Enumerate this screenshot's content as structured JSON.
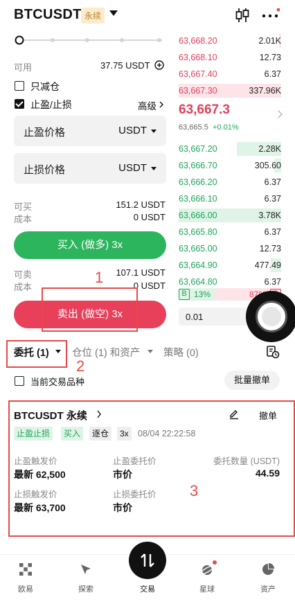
{
  "header": {
    "pair": "BTCUSDT",
    "badge": "永续"
  },
  "form": {
    "available_label": "可用",
    "available_value": "37.75 USDT",
    "reduce_only_label": "只减仓",
    "tpsl_label": "止盈/止损",
    "advanced_label": "高级",
    "tp_field_label": "止盈价格",
    "tp_field_unit": "USDT",
    "sl_field_label": "止损价格",
    "sl_field_unit": "USDT",
    "can_buy_label": "可买",
    "can_buy_value": "151.2 USDT",
    "cost_label": "成本",
    "cost_buy_value": "0 USDT",
    "buy_button": "买入 (做多) 3x",
    "can_sell_label": "可卖",
    "can_sell_value": "107.1 USDT",
    "cost_sell_value": "0 USDT",
    "sell_button": "卖出 (做空) 3x"
  },
  "orderbook": {
    "asks": [
      {
        "price": "63,668.20",
        "qty": "2.01K",
        "depth": 0.02
      },
      {
        "price": "63,668.10",
        "qty": "12.73",
        "depth": 0.0
      },
      {
        "price": "63,667.40",
        "qty": "6.37",
        "depth": 0.0
      },
      {
        "price": "63,667.30",
        "qty": "337.96K",
        "depth": 1.0
      }
    ],
    "last_price": "63,667.3",
    "mark_price": "63,665.5",
    "change": "+0.01%",
    "bids": [
      {
        "price": "63,667.20",
        "qty": "2.28K",
        "depth": 0.43
      },
      {
        "price": "63,666.70",
        "qty": "305.60",
        "depth": 0.07
      },
      {
        "price": "63,666.20",
        "qty": "6.37",
        "depth": 0.0
      },
      {
        "price": "63,666.10",
        "qty": "6.37",
        "depth": 0.0
      },
      {
        "price": "63,666.00",
        "qty": "3.78K",
        "depth": 1.0
      },
      {
        "price": "63,665.80",
        "qty": "6.37",
        "depth": 0.0
      },
      {
        "price": "63,665.00",
        "qty": "12.73",
        "depth": 0.0
      },
      {
        "price": "63,664.90",
        "qty": "477.49",
        "depth": 0.1
      },
      {
        "price": "63,664.80",
        "qty": "6.37",
        "depth": 0.0
      }
    ],
    "buy_badge": "B",
    "sell_badge": "S",
    "buy_ratio": "13%",
    "sell_ratio": "87%",
    "depth_step": "0.01"
  },
  "annotations": [
    "1",
    "2",
    "3"
  ],
  "tabs": {
    "orders": "委托 (1)",
    "positions": "仓位 (1) 和资产",
    "strategy": "策略 (0)",
    "current_pair_filter": "当前交易品种",
    "cancel_all": "批量撤单"
  },
  "order_card": {
    "title": "BTCUSDT 永续",
    "cancel": "撤单",
    "tags": [
      "止盈止损",
      "买入",
      "逐仓",
      "3x"
    ],
    "time": "08/04 22:22:58",
    "tp_trigger_label": "止盈触发价",
    "tp_trigger_value": "最新 62,500",
    "tp_order_label": "止盈委托价",
    "tp_order_value": "市价",
    "qty_label": "委托数量 (USDT)",
    "qty_value": "44.59",
    "sl_trigger_label": "止损触发价",
    "sl_trigger_value": "最新 63,700",
    "sl_order_label": "止损委托价",
    "sl_order_value": "市价"
  },
  "nav": {
    "items": [
      "欧易",
      "探索",
      "交易",
      "星球",
      "资产"
    ]
  },
  "colors": {
    "buy": "#2db55d",
    "sell": "#e8405b",
    "annotation": "#e84848"
  }
}
